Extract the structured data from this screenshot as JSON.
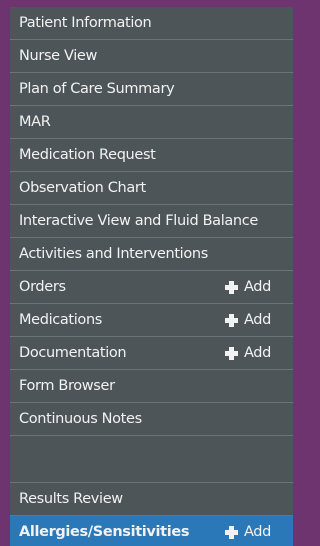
{
  "menu": {
    "items": [
      {
        "label": "Patient Information"
      },
      {
        "label": "Nurse View"
      },
      {
        "label": "Plan of Care Summary"
      },
      {
        "label": "MAR"
      },
      {
        "label": "Medication Request"
      },
      {
        "label": "Observation Chart"
      },
      {
        "label": "Interactive View and Fluid Balance"
      },
      {
        "label": "Activities and Interventions"
      },
      {
        "label": "Orders",
        "action": "Add"
      },
      {
        "label": "Medications",
        "action": "Add"
      },
      {
        "label": "Documentation",
        "action": "Add"
      },
      {
        "label": "Form Browser"
      },
      {
        "label": "Continuous Notes"
      },
      {
        "label": "Results Review"
      },
      {
        "label": "Allergies/Sensitivities",
        "action": "Add",
        "selected": true
      }
    ]
  },
  "colors": {
    "frame_background": "#6e3470",
    "panel_background": "#4e5559",
    "selected_background": "#2a78b8",
    "text": "#f2f2f2"
  },
  "icons": {
    "add": "plus-icon"
  }
}
